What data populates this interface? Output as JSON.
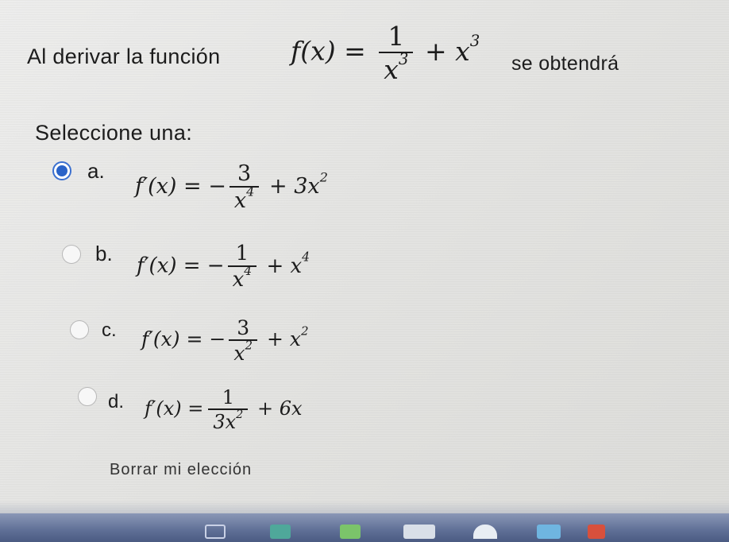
{
  "question": {
    "prefix": "Al derivar la función",
    "function_lhs": "f(x) =",
    "function_num": "1",
    "function_den_base": "x",
    "function_den_exp": "3",
    "function_tail_base": "+ x",
    "function_tail_exp": "3",
    "suffix": "se obtendrá"
  },
  "prompt": "Seleccione una:",
  "options": [
    {
      "letter": "a.",
      "selected": true,
      "lhs": "f′(x) = −",
      "num": "3",
      "den_base": "x",
      "den_exp": "4",
      "tail_base": "+ 3x",
      "tail_exp": "2"
    },
    {
      "letter": "b.",
      "selected": false,
      "lhs": "f′(x) = −",
      "num": "1",
      "den_base": "x",
      "den_exp": "4",
      "tail_base": "+ x",
      "tail_exp": "4"
    },
    {
      "letter": "c.",
      "selected": false,
      "lhs": "f′(x) = −",
      "num": "3",
      "den_base": "x",
      "den_exp": "2",
      "tail_base": "+ x",
      "tail_exp": "2"
    },
    {
      "letter": "d.",
      "selected": false,
      "lhs": "f′(x) =",
      "num": "1",
      "den_base": "3x",
      "den_exp": "2",
      "tail_base": "+ 6x",
      "tail_exp": ""
    }
  ],
  "clear_choice": "Borrar mi elección",
  "colors": {
    "radio_selected": "#2a63c8",
    "taskbar": "#5f6f96"
  }
}
